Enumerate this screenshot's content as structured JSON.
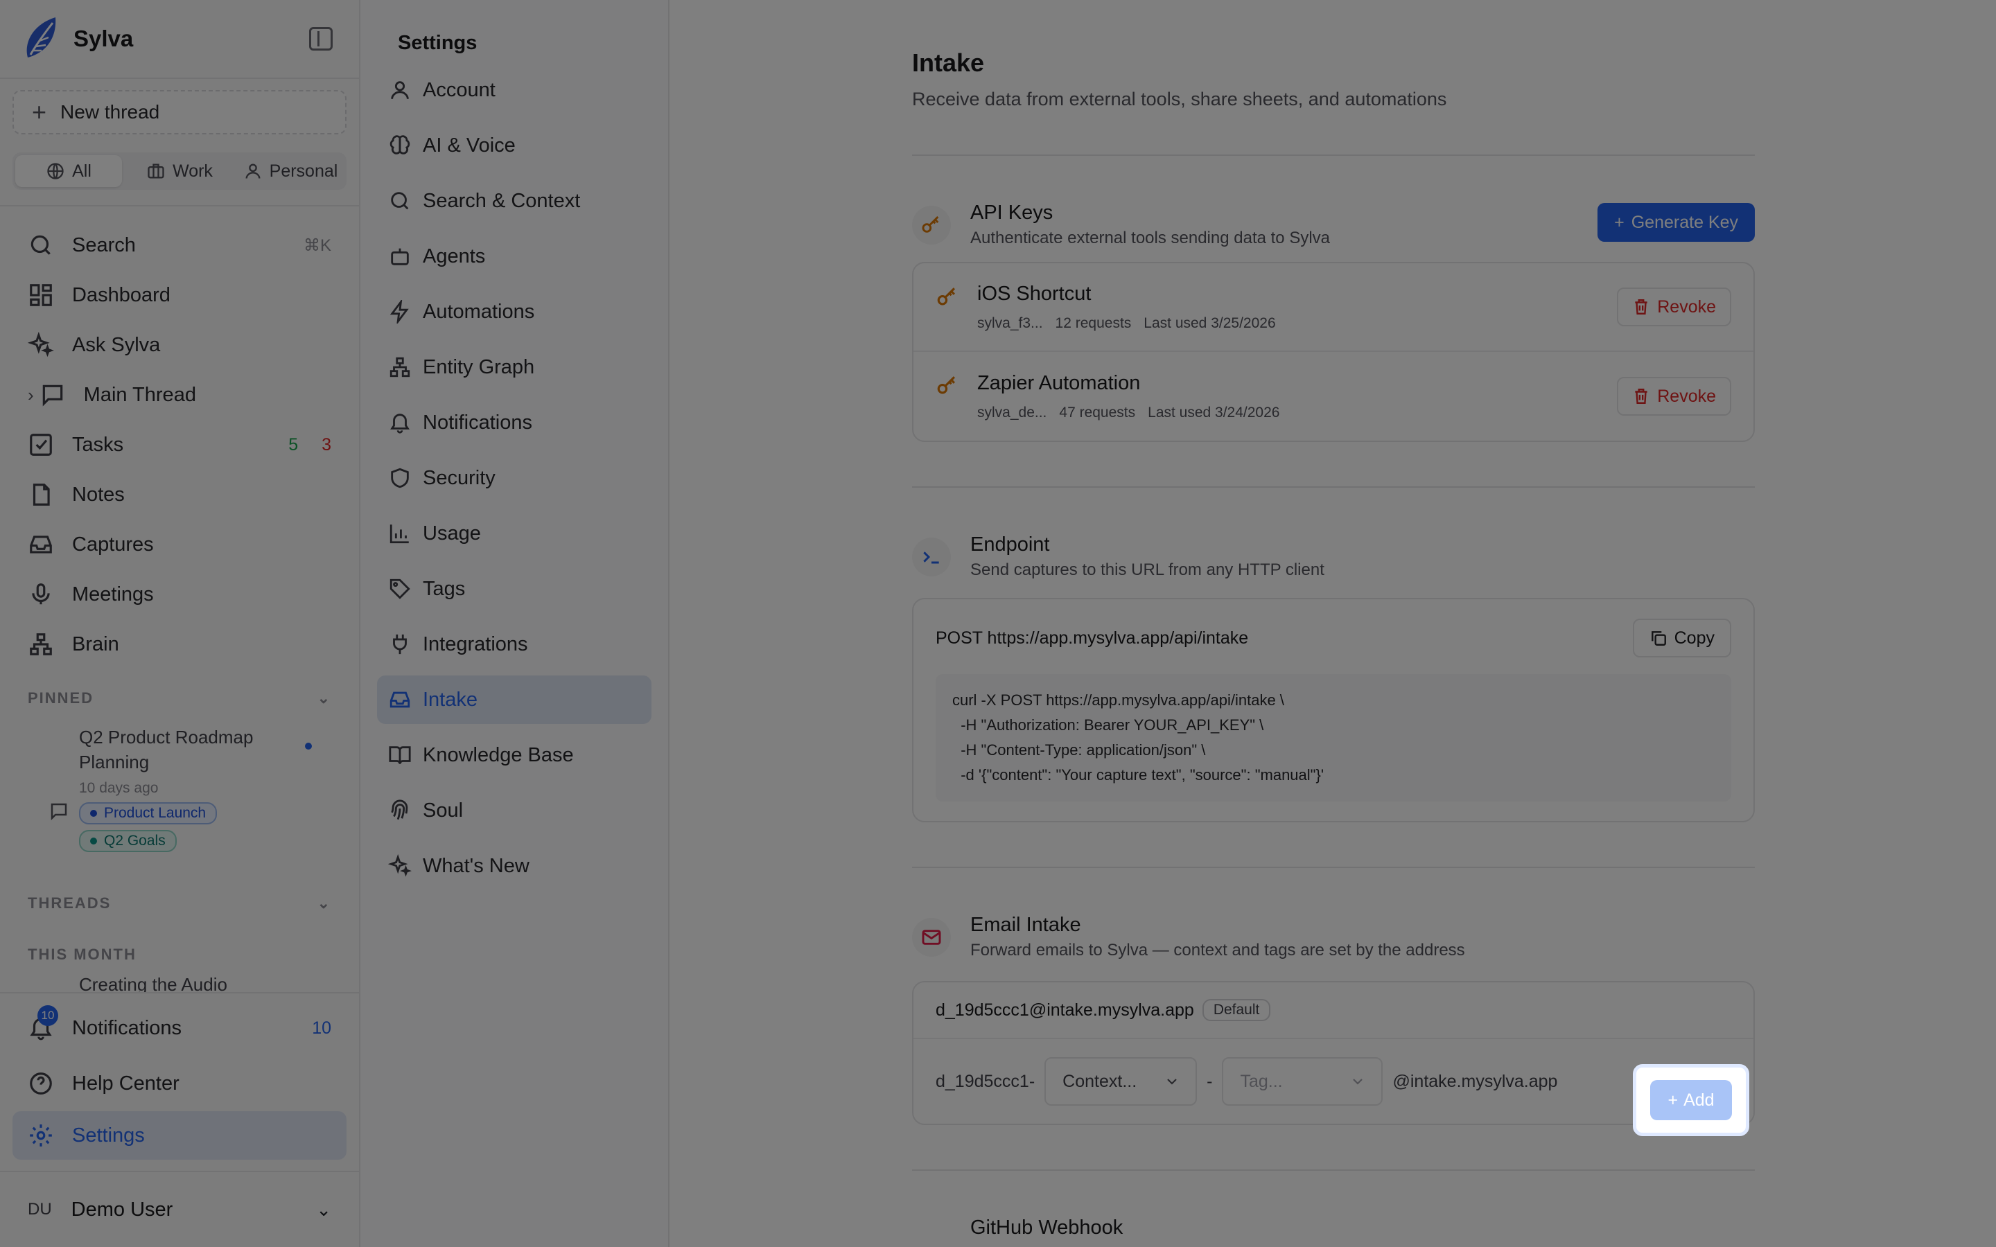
{
  "brand": {
    "name": "Sylva"
  },
  "sidebar": {
    "new_thread": "New thread",
    "filters": [
      "All",
      "Work",
      "Personal"
    ],
    "search_label": "Search",
    "search_shortcut": "⌘K",
    "items": [
      {
        "label": "Dashboard"
      },
      {
        "label": "Ask Sylva"
      },
      {
        "label": "Main Thread"
      },
      {
        "label": "Tasks",
        "count_green": "5",
        "count_red": "3"
      },
      {
        "label": "Notes"
      },
      {
        "label": "Captures"
      },
      {
        "label": "Meetings"
      },
      {
        "label": "Brain"
      }
    ],
    "pinned_title": "PINNED",
    "pinned": {
      "title": "Q2 Product Roadmap Planning",
      "age": "10 days ago",
      "tags": [
        "Product Launch",
        "Q2 Goals"
      ]
    },
    "threads_title": "THREADS",
    "month_title": "THIS MONTH",
    "month_item": "Creating the Audio",
    "notifications_label": "Notifications",
    "notifications_badge": "10",
    "notifications_count": "10",
    "help_label": "Help Center",
    "settings_label": "Settings",
    "user_initials": "DU",
    "user_name": "Demo User"
  },
  "settings_nav": {
    "title": "Settings",
    "items": [
      "Account",
      "AI & Voice",
      "Search & Context",
      "Agents",
      "Automations",
      "Entity Graph",
      "Notifications",
      "Security",
      "Usage",
      "Tags",
      "Integrations",
      "Intake",
      "Knowledge Base",
      "Soul",
      "What's New"
    ],
    "active": "Intake"
  },
  "main": {
    "title": "Intake",
    "subtitle": "Receive data from external tools, share sheets, and automations",
    "api_keys": {
      "title": "API Keys",
      "desc": "Authenticate external tools sending data to Sylva",
      "generate_label": "Generate Key",
      "keys": [
        {
          "name": "iOS Shortcut",
          "prefix": "sylva_f3...",
          "requests": "12 requests",
          "last_used": "Last used 3/25/2026",
          "revoke_label": "Revoke"
        },
        {
          "name": "Zapier Automation",
          "prefix": "sylva_de...",
          "requests": "47 requests",
          "last_used": "Last used 3/24/2026",
          "revoke_label": "Revoke"
        }
      ]
    },
    "endpoint": {
      "title": "Endpoint",
      "desc": "Send captures to this URL from any HTTP client",
      "url": "POST https://app.mysylva.app/api/intake",
      "copy_label": "Copy",
      "code_lines": [
        "curl -X POST https://app.mysylva.app/api/intake \\",
        "  -H \"Authorization: Bearer YOUR_API_KEY\" \\",
        "  -H \"Content-Type: application/json\" \\",
        "  -d '{\"content\": \"Your capture text\", \"source\": \"manual\"}'"
      ]
    },
    "email": {
      "title": "Email Intake",
      "desc": "Forward emails to Sylva — context and tags are set by the address",
      "default_address": "d_19d5ccc1@intake.mysylva.app",
      "default_label": "Default",
      "prefix": "d_19d5ccc1-",
      "context_placeholder": "Context...",
      "separator": "-",
      "tag_placeholder": "Tag...",
      "suffix": "@intake.mysylva.app",
      "add_label": "Add"
    },
    "github": {
      "title": "GitHub Webhook"
    }
  },
  "colors": {
    "accent": "#2563eb",
    "danger": "#dc2626",
    "key_icon": "#d97706",
    "mail_icon": "#e11d48"
  }
}
